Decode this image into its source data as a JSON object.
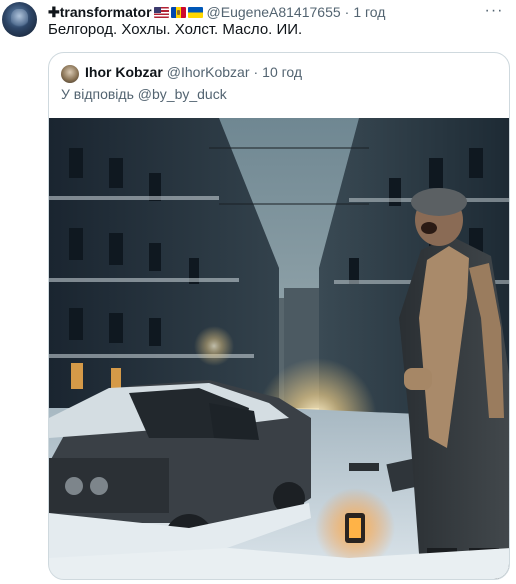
{
  "post": {
    "display_name": "transformator",
    "name_prefix": "✚",
    "flags": [
      "us-flag",
      "moldova-flag",
      "ukraine-flag"
    ],
    "handle": "@EugeneA81417655",
    "separator": "·",
    "time": "1 год",
    "more_label": "···",
    "text": "Белгород. Хохлы. Холст. Масло. ИИ."
  },
  "quoted": {
    "display_name": "Ihor Kobzar",
    "handle": "@IhorKobzar",
    "separator": "·",
    "time": "10 год",
    "reply_prefix": "У відповідь ",
    "reply_mention": "@by_by_duck"
  },
  "colors": {
    "text_primary": "#0f1419",
    "text_secondary": "#536471",
    "border": "#cfd9de"
  }
}
